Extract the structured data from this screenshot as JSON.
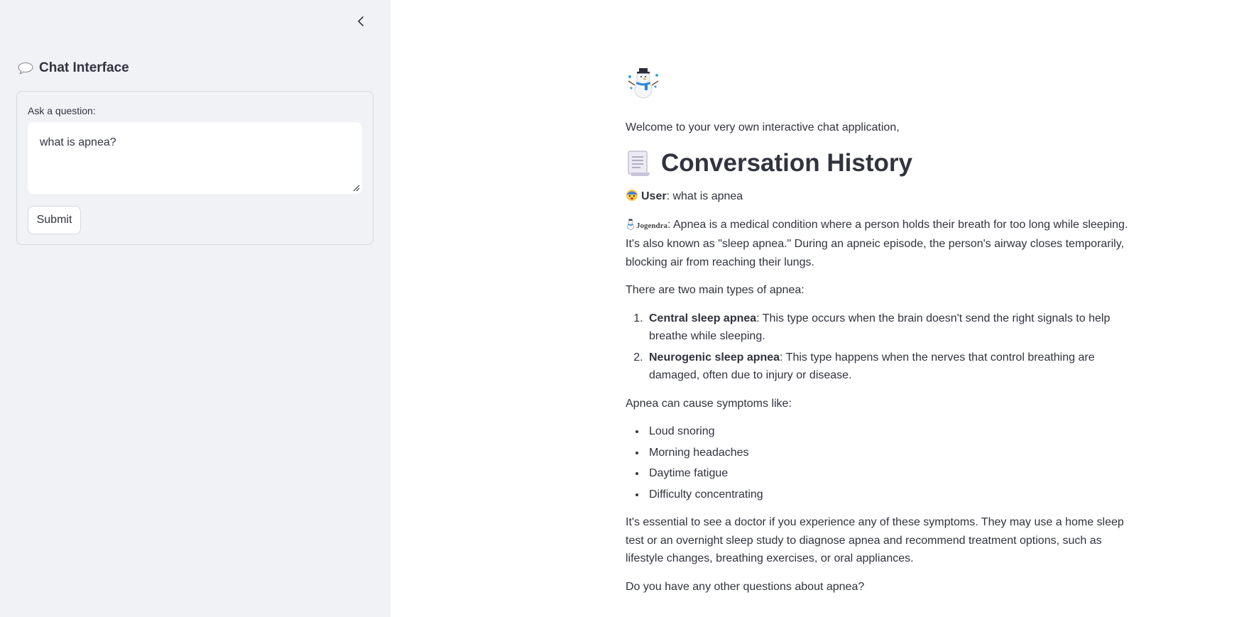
{
  "sidebar": {
    "title": "Chat Interface",
    "title_icon": "speech-balloon-icon",
    "collapse_icon": "chevron-left-icon",
    "form": {
      "label": "Ask a question:",
      "input_value": "what is apnea?",
      "submit_label": "Submit"
    }
  },
  "main": {
    "logo_icon": "snowman-icon",
    "welcome": "Welcome to your very own interactive chat application,",
    "history_heading": "Conversation History",
    "history_icon": "scroll-icon",
    "user_message": {
      "speaker": "User",
      "sep": ": ",
      "text": "what is apnea"
    },
    "bot_message": {
      "speaker": "Jogendra",
      "intro": ": Apnea is a medical condition where a person holds their breath for too long while sleeping. It's also known as \"sleep apnea.\" During an apneic episode, the person's airway closes temporarily, blocking air from reaching their lungs.",
      "types_intro": "There are two main types of apnea:",
      "types": [
        {
          "name": "Central sleep apnea",
          "desc": ": This type occurs when the brain doesn't send the right signals to help breathe while sleeping."
        },
        {
          "name": "Neurogenic sleep apnea",
          "desc": ": This type happens when the nerves that control breathing are damaged, often due to injury or disease."
        }
      ],
      "symptoms_intro": "Apnea can cause symptoms like:",
      "symptoms": [
        "Loud snoring",
        "Morning headaches",
        "Daytime fatigue",
        "Difficulty concentrating"
      ],
      "advice": "It's essential to see a doctor if you experience any of these symptoms. They may use a home sleep test or an overnight sleep study to diagnose apnea and recommend treatment options, such as lifestyle changes, breathing exercises, or oral appliances.",
      "closing": "Do you have any other questions about apnea?"
    }
  }
}
